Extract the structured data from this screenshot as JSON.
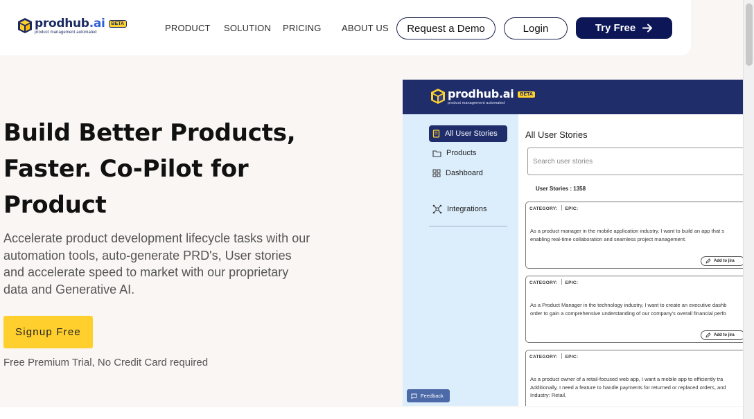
{
  "brand": {
    "name_main": "prodhub",
    "name_ai": ".ai",
    "badge": "BETA",
    "tagline": "product management automated"
  },
  "nav": {
    "links": [
      "PRODUCT",
      "SOLUTION",
      "PRICING",
      "ABOUT US"
    ],
    "request_demo": "Request a Demo",
    "login": "Login",
    "try_free": "Try Free"
  },
  "hero": {
    "title_lines": [
      "Build Better Products,",
      "Faster. Co-Pilot for",
      "Product"
    ],
    "description": "Accelerate product development lifecycle tasks with our automation tools, auto-generate PRD's, User stories and accelerate speed to market with our proprietary data and Generative AI.",
    "signup": "Signup Free",
    "note": "Free Premium Trial, No Credit Card required"
  },
  "mockup": {
    "sidebar": {
      "items": [
        "All User Stories",
        "Products",
        "Dashboard",
        "Integrations"
      ],
      "feedback": "Feedback"
    },
    "main": {
      "title": "All User Stories",
      "search_placeholder": "Search user stories",
      "count_label": "User Stories : 1358",
      "cards": [
        {
          "category": "CATEGORY:",
          "epic": "EPIC:",
          "lines": [
            "As a product manager in the mobile application industry, I want to build an app that s",
            "enabling real-time collaboration and seamless project management."
          ],
          "action": "Add to jira"
        },
        {
          "category": "CATEGORY:",
          "epic": "EPIC:",
          "lines": [
            "As a Product Manager in the technology industry, I want to create an executive dashb",
            "order to gain a comprehensive understanding of our company's overall financial perfo"
          ],
          "action": "Add to jira"
        },
        {
          "category": "CATEGORY:",
          "epic": "EPIC:",
          "lines": [
            "As a product owner of a retail-focused web app, I want a mobile app to efficiently tra",
            "Additionally, I need a feature to handle payments for returned or replaced orders, and",
            "Industry: Retail."
          ],
          "action": ""
        }
      ]
    }
  },
  "colors": {
    "navy": "#0d1657",
    "mock_header": "#1f2d6b",
    "accent_yellow": "#ffcf2e",
    "sidebar_bg": "#dcedfb",
    "page_bg": "#f9f6f3"
  }
}
